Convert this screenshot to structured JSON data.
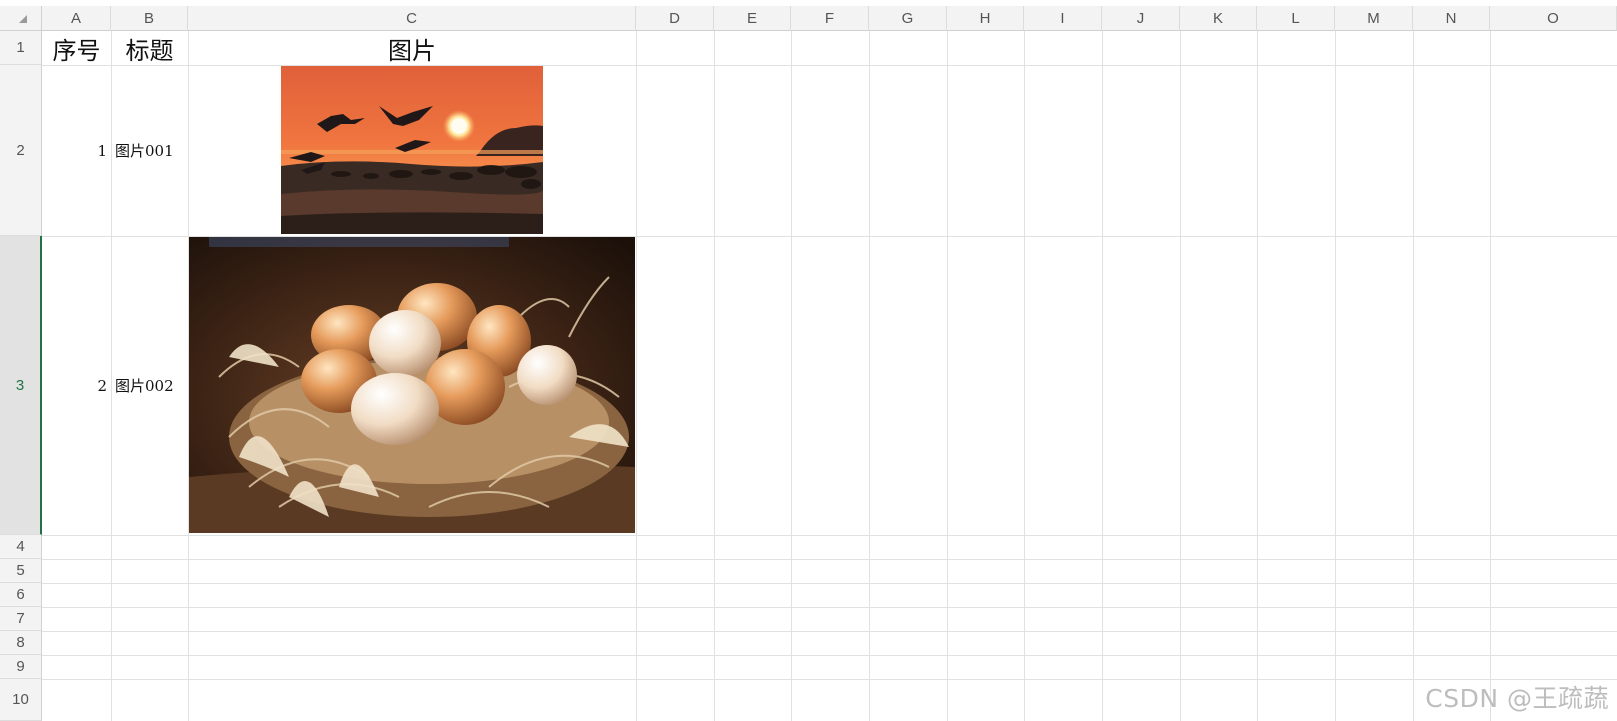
{
  "sheet": {
    "column_headers": [
      "A",
      "B",
      "C",
      "D",
      "E",
      "F",
      "G",
      "H",
      "I",
      "J",
      "K",
      "L",
      "M",
      "N",
      "O"
    ],
    "row_headers": [
      "1",
      "2",
      "3",
      "4",
      "5",
      "6",
      "7",
      "8",
      "9",
      "10"
    ],
    "selected_row": "3",
    "header_row": {
      "a": "序号",
      "b": "标题",
      "c": "图片"
    },
    "rows": [
      {
        "number": "1",
        "title": "图片001",
        "image": "sunset-birds-image"
      },
      {
        "number": "2",
        "title": "图片002",
        "image": "eggs-in-nest-image"
      }
    ]
  },
  "watermark": "CSDN @王疏蔬",
  "colors": {
    "selection": "#217346",
    "header_bg": "#f3f3f3",
    "grid": "#e1e1e1"
  }
}
